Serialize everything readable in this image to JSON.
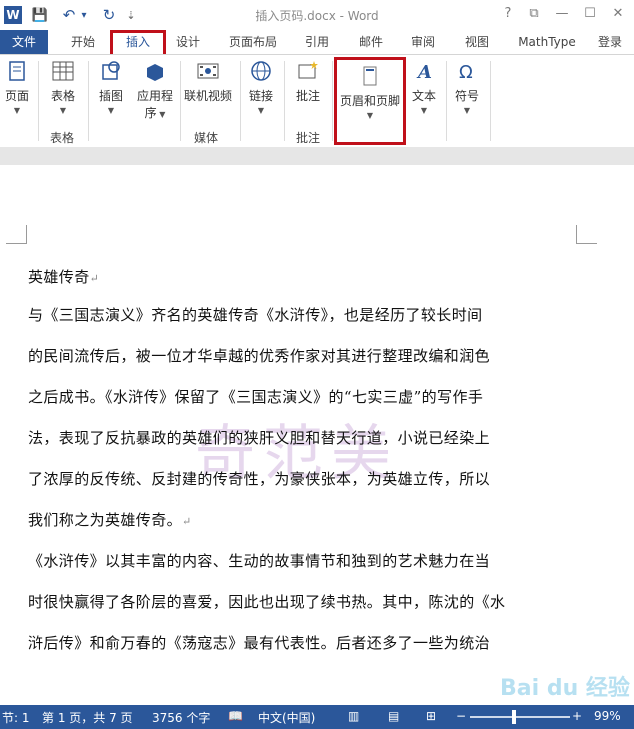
{
  "app": {
    "title": "插入页码.docx - Word",
    "qat": {
      "word_icon": "word-logo-icon",
      "save": "💾",
      "undo": "↶",
      "undo_drop": "▾",
      "redo": "↻",
      "customize": "⇣"
    },
    "window": {
      "help": "?",
      "restore_ribbon": "⧉",
      "minimize": "—",
      "maximize": "☐",
      "close": "✕"
    }
  },
  "tabs": [
    "文件",
    "开始",
    "插入",
    "设计",
    "页面布局",
    "引用",
    "邮件",
    "审阅",
    "视图",
    "MathType",
    "登录"
  ],
  "ribbon": {
    "page": "页面",
    "table": "表格",
    "pictures": "插图",
    "apps": "应用程",
    "apps2": "序",
    "online_video": "联机视频",
    "link": "链接",
    "comment": "批注",
    "header_footer": "页眉和页脚",
    "text": "文本",
    "symbol": "符号",
    "groups": {
      "table": "表格",
      "media": "媒体",
      "comment": "批注"
    }
  },
  "document": {
    "lines": [
      "英雄传奇",
      "与《三国志演义》齐名的英雄传奇《水浒传》，也是经历了较长时间",
      "的民间流传后，被一位才华卓越的优秀作家对其进行整理改编和润色",
      "之后成书。《水浒传》保留了《三国志演义》的“七实三虚”的写作手",
      "法，表现了反抗暴政的英雄们的狭肝义胆和替天行道，小说已经染上",
      "了浓厚的反传统、反封建的传奇性，为豪侠张本，为英雄立传，所以",
      "我们称之为英雄传奇。",
      "《水浒传》以其丰富的内容、生动的故事情节和独到的艺术魅力在当",
      "时很快赢得了各阶层的喜爱，因此也出现了续书热。其中，陈沈的《水",
      "浒后传》和俞万春的《荡寇志》最有代表性。后者还多了一些为统治"
    ],
    "para_mark": "↵",
    "watermark": "奇范美",
    "baidu_watermark": "Bai du 经验"
  },
  "status": {
    "section": "节: 1",
    "page": "第 1 页，共 7 页",
    "words": "3756 个字",
    "language": "中文(中国)",
    "zoom": "99%",
    "zoom_minus": "−",
    "zoom_plus": "+"
  },
  "colors": {
    "accent": "#2b579a",
    "highlight": "#c0101a"
  }
}
